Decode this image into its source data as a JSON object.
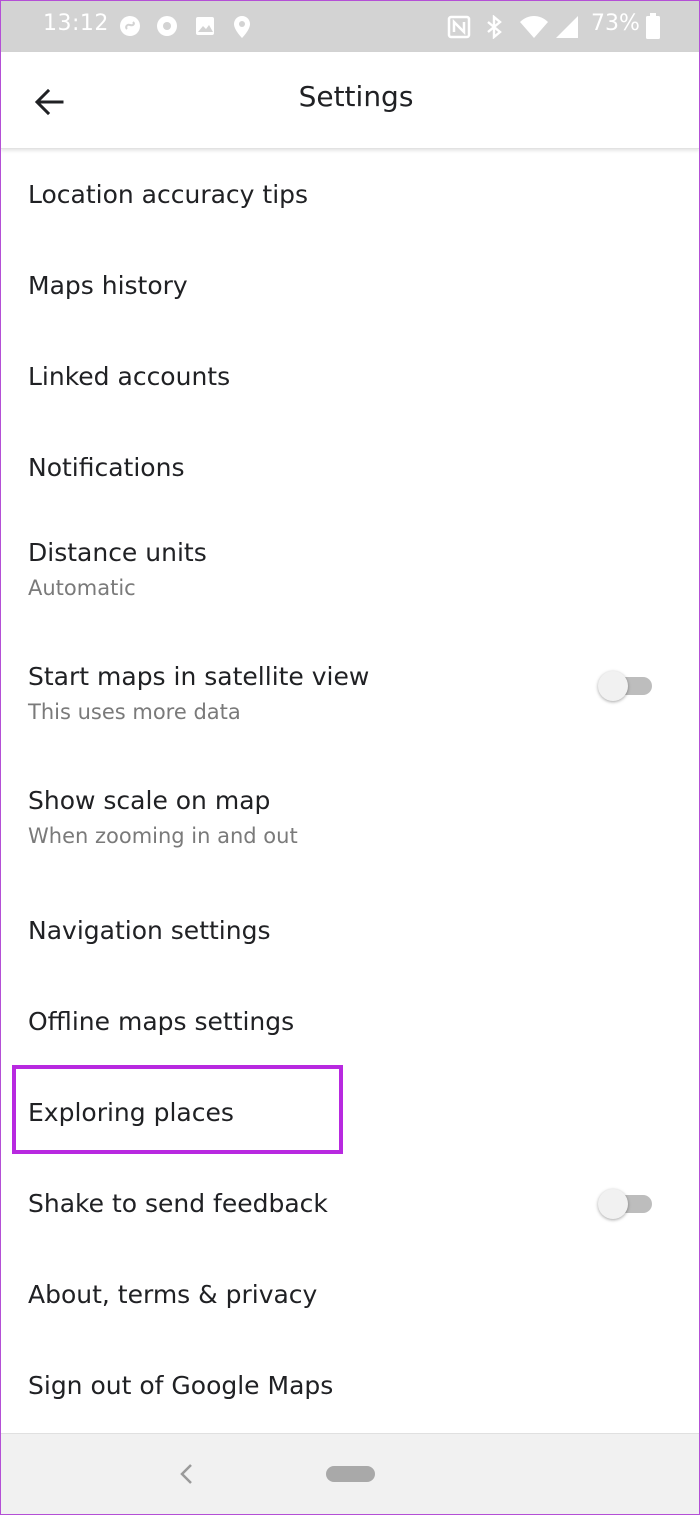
{
  "status_bar": {
    "time": "13:12",
    "left_icons": [
      "shazam-icon",
      "record-icon",
      "image-icon",
      "location-pin-icon"
    ],
    "right_icons": [
      "nfc-icon",
      "bluetooth-icon",
      "wifi-icon",
      "cell-signal-icon",
      "battery-icon"
    ],
    "battery_percent": "73%"
  },
  "app_bar": {
    "title": "Settings",
    "back_icon": "arrow-back-icon"
  },
  "settings": {
    "items": [
      {
        "label": "Location accuracy tips"
      },
      {
        "label": "Maps history"
      },
      {
        "label": "Linked accounts"
      },
      {
        "label": "Notifications"
      },
      {
        "label": "Distance units",
        "sub": "Automatic"
      },
      {
        "label": "Start maps in satellite view",
        "sub": "This uses more data",
        "toggle": false
      },
      {
        "label": "Show scale on map",
        "sub": "When zooming in and out"
      },
      {
        "label": "Navigation settings"
      },
      {
        "label": "Offline maps settings"
      },
      {
        "label": "Exploring places",
        "highlighted": true
      },
      {
        "label": "Shake to send feedback",
        "toggle": false
      },
      {
        "label": "About, terms & privacy"
      },
      {
        "label": "Sign out of Google Maps"
      }
    ]
  },
  "colors": {
    "highlight": "#b829e0",
    "status_bar_bg": "#d3d3d3",
    "text_primary": "#202124",
    "text_secondary": "#7a7a7a"
  },
  "nav_bar": {
    "icons": [
      "nav-back-icon",
      "home-pill-icon"
    ]
  }
}
